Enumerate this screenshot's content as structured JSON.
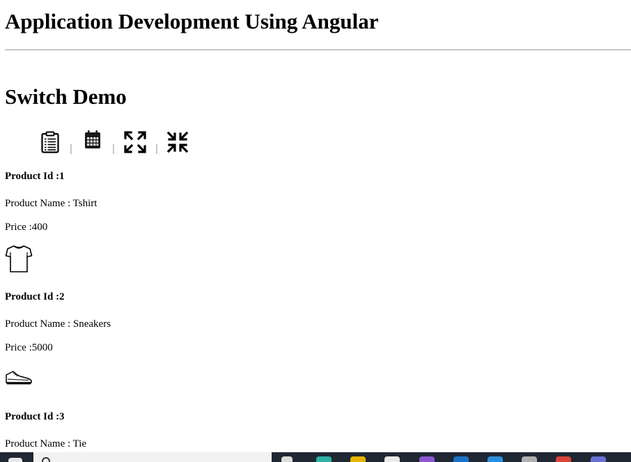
{
  "header": {
    "title": "Application Development Using Angular"
  },
  "main": {
    "title": "Switch Demo",
    "toolbar": {
      "buttons": [
        {
          "name": "list-view",
          "icon": "clipboard-list-icon"
        },
        {
          "name": "calendar-view",
          "icon": "calendar-icon"
        },
        {
          "name": "expand",
          "icon": "expand-icon"
        },
        {
          "name": "compress",
          "icon": "compress-icon"
        }
      ],
      "separator": "|"
    },
    "products": [
      {
        "id_label": "Product Id :1",
        "name_label": "Product Name : Tshirt",
        "price_label": "Price :400",
        "icon": "tshirt-icon"
      },
      {
        "id_label": "Product Id :2",
        "name_label": "Product Name : Sneakers",
        "price_label": "Price :5000",
        "icon": "sneaker-icon"
      },
      {
        "id_label": "Product Id :3",
        "name_label": "Product Name : Tie"
      }
    ]
  },
  "taskbar": {
    "icons": [
      "windows-start-icon",
      "search-icon",
      "task-view-icon",
      "edge-icon",
      "file-explorer-icon",
      "store-icon",
      "visual-studio-icon",
      "outlook-icon",
      "vscode-icon",
      "terminal-icon",
      "chrome-icon",
      "teams-icon"
    ],
    "colors": {
      "background": "#1f2833",
      "search": "#f2f2f2"
    }
  }
}
